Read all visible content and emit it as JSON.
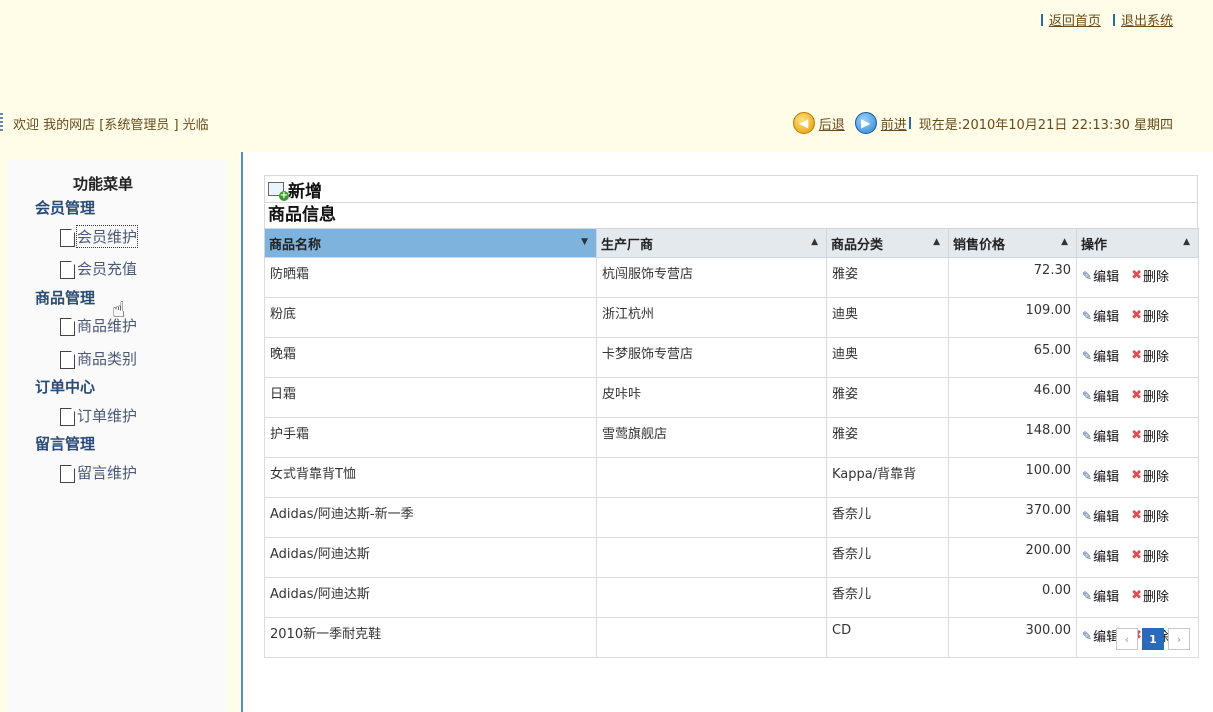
{
  "header": {
    "home_link": "返回首页",
    "logout_link": "退出系统",
    "welcome": "欢迎  我的网店  [系统管理员 ] 光临",
    "back": "后退",
    "forward": "前进",
    "datetime": "现在是:2010年10月21日  22:13:30 星期四"
  },
  "sidebar": {
    "title": "功能菜单",
    "groups": [
      {
        "label": "会员管理",
        "items": [
          {
            "label": "会员维护"
          },
          {
            "label": "会员充值"
          }
        ]
      },
      {
        "label": "商品管理",
        "items": [
          {
            "label": "商品维护"
          },
          {
            "label": "商品类别"
          }
        ]
      },
      {
        "label": "订单中心",
        "items": [
          {
            "label": "订单维护"
          }
        ]
      },
      {
        "label": "留言管理",
        "items": [
          {
            "label": "留言维护"
          }
        ]
      }
    ]
  },
  "main": {
    "add_label": "新增",
    "section_title": "商品信息",
    "columns": [
      "商品名称",
      "生产厂商",
      "商品分类",
      "销售价格",
      "操作"
    ],
    "edit_label": "编辑",
    "delete_label": "删除",
    "rows": [
      {
        "name": "防晒霜",
        "maker": "杭闯服饰专营店",
        "category": "雅姿",
        "price": "72.30"
      },
      {
        "name": "粉底",
        "maker": "浙江杭州",
        "category": "迪奥",
        "price": "109.00"
      },
      {
        "name": "晚霜",
        "maker": "卡梦服饰专营店",
        "category": "迪奥",
        "price": "65.00"
      },
      {
        "name": "日霜",
        "maker": "皮咔咔",
        "category": "雅姿",
        "price": "46.00"
      },
      {
        "name": "护手霜",
        "maker": "雪莺旗舰店",
        "category": "雅姿",
        "price": "148.00"
      },
      {
        "name": "女式背靠背T恤",
        "maker": "",
        "category": "Kappa/背靠背",
        "price": "100.00"
      },
      {
        "name": "Adidas/阿迪达斯-新一季",
        "maker": "",
        "category": "香奈儿",
        "price": "370.00"
      },
      {
        "name": "Adidas/阿迪达斯",
        "maker": "",
        "category": "香奈儿",
        "price": "200.00"
      },
      {
        "name": "Adidas/阿迪达斯",
        "maker": "",
        "category": "香奈儿",
        "price": "0.00"
      },
      {
        "name": "2010新一季耐克鞋",
        "maker": "",
        "category": "CD",
        "price": "300.00"
      }
    ],
    "pager": {
      "prev": "‹",
      "current": "1",
      "next": "›"
    }
  }
}
